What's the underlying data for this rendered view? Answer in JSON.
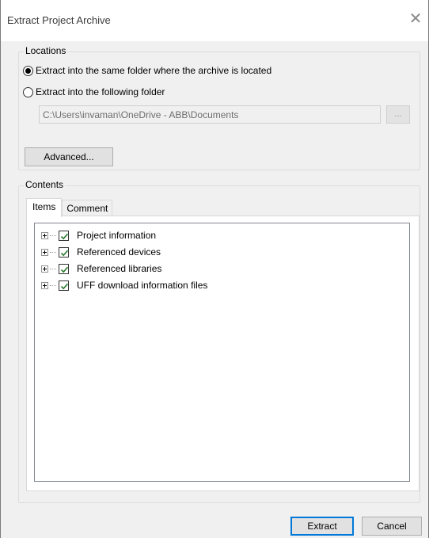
{
  "window": {
    "title": "Extract Project Archive",
    "close_glyph": "✕"
  },
  "locations": {
    "label": "Locations",
    "option_same": "Extract into the same folder where the archive is located",
    "option_following": "Extract into the following folder",
    "selected": "same",
    "folder_path": "C:\\Users\\invaman\\OneDrive - ABB\\Documents",
    "browse_label": "...",
    "advanced_label": "Advanced..."
  },
  "contents": {
    "label": "Contents",
    "tabs": [
      {
        "label": "Items",
        "active": true
      },
      {
        "label": "Comment",
        "active": false
      }
    ],
    "items": [
      {
        "label": "Project information",
        "checked": true
      },
      {
        "label": "Referenced devices",
        "checked": true
      },
      {
        "label": "Referenced libraries",
        "checked": true
      },
      {
        "label": "UFF download information files",
        "checked": true
      }
    ]
  },
  "footer": {
    "extract_label": "Extract",
    "cancel_label": "Cancel"
  },
  "colors": {
    "accent": "#0078d7",
    "check": "#2f7d31"
  }
}
